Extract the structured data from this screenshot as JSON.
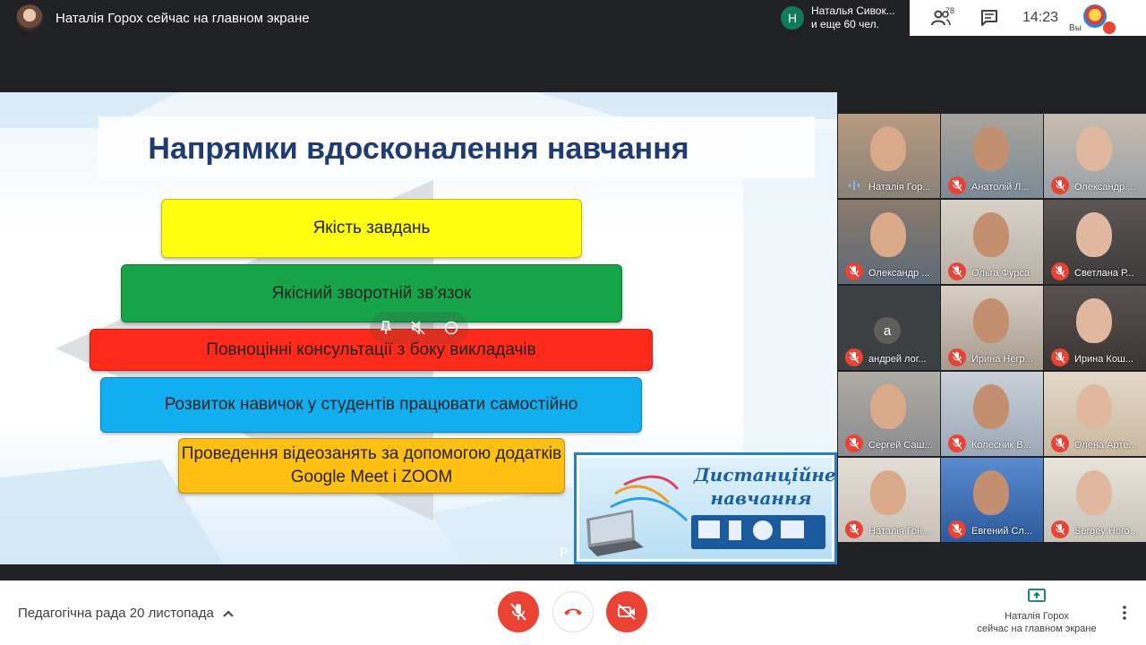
{
  "top": {
    "presenter_title": "Наталія Горох сейчас на главном экране",
    "join_avatar_letter": "Н",
    "join_line1": "Наталья Сивок...",
    "join_line2": "и еще 60 чел.",
    "people_count": "78",
    "clock": "14:23",
    "self_label": "Вы",
    "icons": [
      "people-icon",
      "chat-icon",
      "mic-off-icon"
    ]
  },
  "slide": {
    "title": "Напрямки вдосконалення навчання",
    "bars": [
      {
        "text": "Якість завдань",
        "color": "#ffff0f"
      },
      {
        "text": "Якісний зворотній зв’язок",
        "color": "#16a34a"
      },
      {
        "text": "Повноцінні консультації з боку викладачів",
        "color": "#ff2a1a"
      },
      {
        "text": "Розвиток навичок  у студентів працювати самостійно",
        "color": "#11aef0"
      },
      {
        "text": "Проведення відеозанять за допомогою додатків Google Meet і ZOOM",
        "color": "#ffc012"
      }
    ],
    "badge_line1": "Дистанційне",
    "badge_line2": "навчання",
    "corner_text": "P"
  },
  "tiles": [
    {
      "name": "Наталія Гор...",
      "speaking": true
    },
    {
      "name": "Анатолій Л...",
      "speaking": false
    },
    {
      "name": "Олександр ...",
      "speaking": false
    },
    {
      "name": "Олександр ...",
      "speaking": false
    },
    {
      "name": "Ольга Фурса",
      "speaking": false
    },
    {
      "name": "Светлана Р...",
      "speaking": false
    },
    {
      "name": "андрей лог...",
      "speaking": false,
      "letter": "а"
    },
    {
      "name": "Ирина Негр...",
      "speaking": false
    },
    {
      "name": "Ирина Кош...",
      "speaking": false
    },
    {
      "name": "Сергей Саш...",
      "speaking": false
    },
    {
      "name": "Колесник В...",
      "speaking": false
    },
    {
      "name": "Олена Арте...",
      "speaking": false
    },
    {
      "name": "Наталія Гон...",
      "speaking": false
    },
    {
      "name": "Евгений Сл...",
      "speaking": false
    },
    {
      "name": "Sergey Horo...",
      "speaking": false
    }
  ],
  "bottom": {
    "meeting_title": "Педагогічна рада 20 листопада",
    "present_line1": "Наталія Горох",
    "present_line2": "сейчас на главном экране"
  },
  "colors": {
    "accent_red": "#ea4335",
    "dark_bg": "#202124",
    "title_blue": "#1f3b73"
  }
}
